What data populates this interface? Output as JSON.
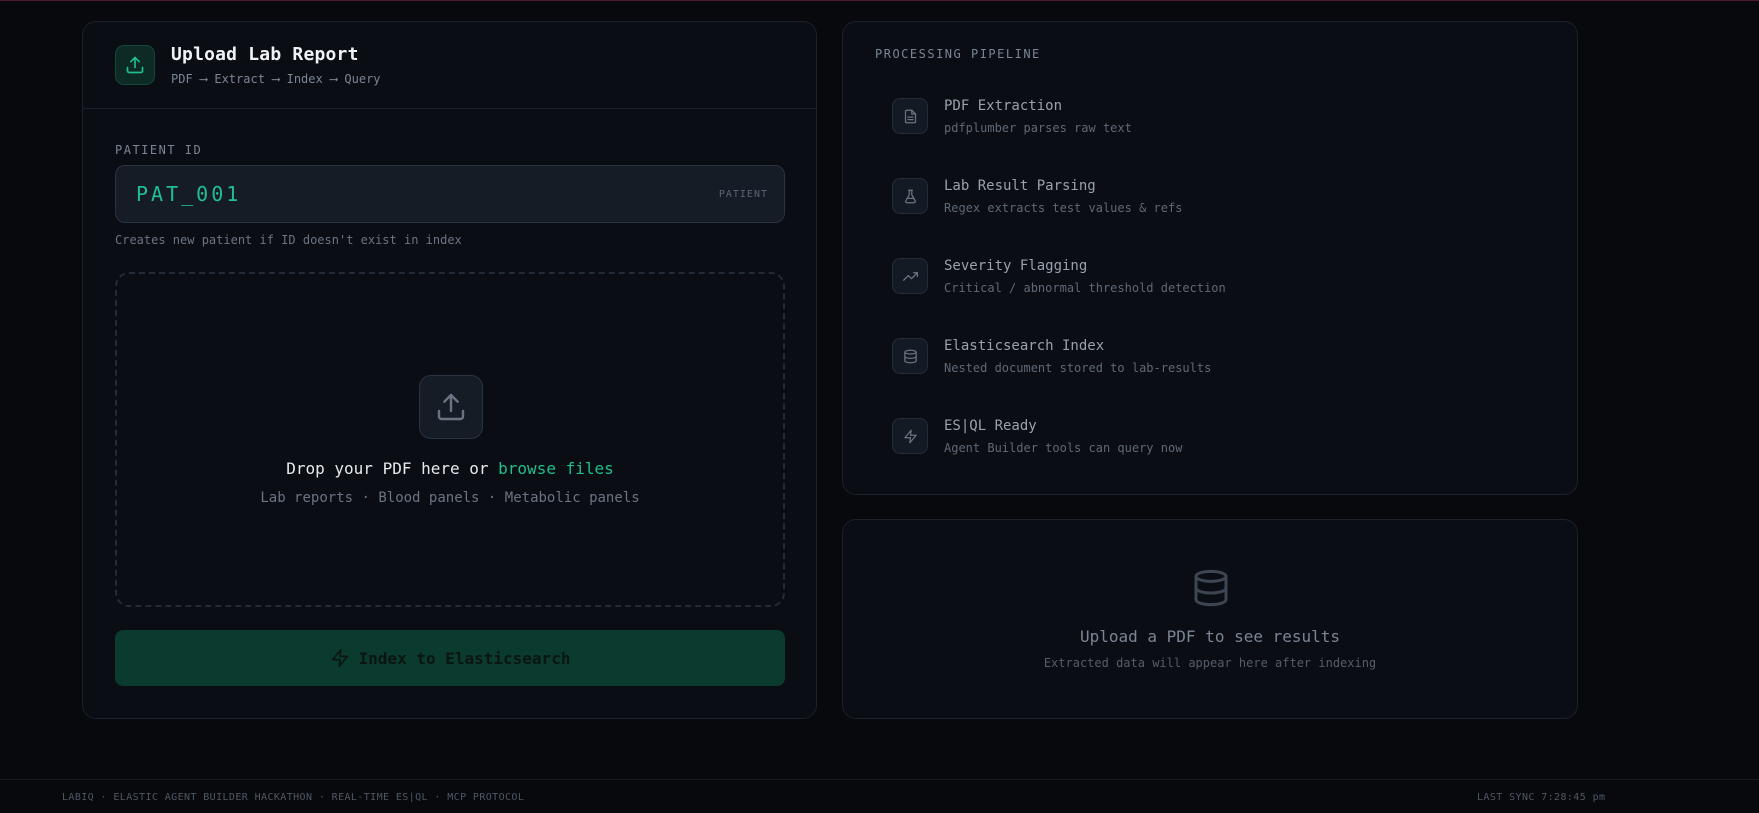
{
  "upload": {
    "title": "Upload Lab Report",
    "subtitle": "PDF ⟶ Extract ⟶ Index ⟶ Query",
    "patient_id_label": "PATIENT ID",
    "patient_id_value": "PAT_001",
    "patient_tag": "PATIENT",
    "patient_hint": "Creates new patient if ID doesn't exist in index",
    "drop_text": "Drop your PDF here or ",
    "drop_link": "browse files",
    "drop_formats": "Lab reports · Blood panels · Metabolic panels",
    "index_button": "Index to Elasticsearch"
  },
  "pipeline": {
    "title": "PROCESSING PIPELINE",
    "steps": [
      {
        "name": "PDF Extraction",
        "desc": "pdfplumber parses raw text",
        "icon": "file-text-icon"
      },
      {
        "name": "Lab Result Parsing",
        "desc": "Regex extracts test values & refs",
        "icon": "flask-icon"
      },
      {
        "name": "Severity Flagging",
        "desc": "Critical / abnormal threshold detection",
        "icon": "trending-up-icon"
      },
      {
        "name": "Elasticsearch Index",
        "desc": "Nested document stored to lab-results",
        "icon": "database-icon"
      },
      {
        "name": "ES|QL Ready",
        "desc": "Agent Builder tools can query now",
        "icon": "zap-icon"
      }
    ]
  },
  "results": {
    "title": "Upload a PDF to see results",
    "subtitle": "Extracted data will appear here after indexing",
    "icon": "database-icon"
  },
  "footer": {
    "left": "LABIQ · ELASTIC AGENT BUILDER HACKATHON · REAL-TIME ES|QL · MCP PROTOCOL",
    "right": "LAST SYNC 7:28:45 pm"
  },
  "colors": {
    "accent": "#1fbf8f",
    "background": "#07090d",
    "card": "#0a0d13",
    "button": "#0b3b2e"
  }
}
